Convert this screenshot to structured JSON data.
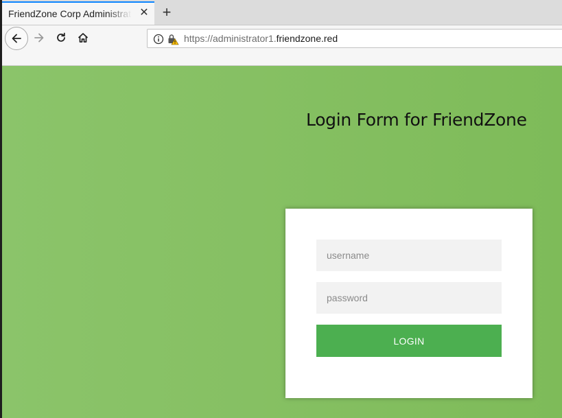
{
  "browser": {
    "tab_title": "FriendZone Corp Administrator",
    "tab_close": "✕",
    "new_tab": "+",
    "url_prefix": "https://administrator1.",
    "url_domain": "friendzone.red"
  },
  "page": {
    "title": "Login Form for FriendZone",
    "background_color": "#86c063",
    "form": {
      "username_placeholder": "username",
      "username_value": "",
      "password_placeholder": "password",
      "password_value": "",
      "login_label": "LOGIN",
      "login_color": "#4caf50"
    }
  }
}
